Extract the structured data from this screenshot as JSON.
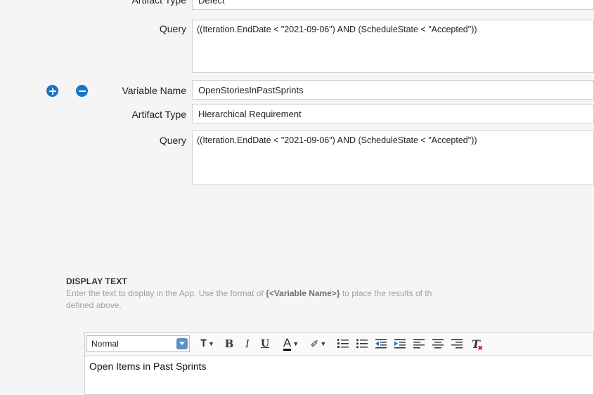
{
  "top_block": {
    "artifact_type_label": "Artifact Type",
    "artifact_type_value": "Defect",
    "query_label": "Query",
    "query_value": "((Iteration.EndDate < \"2021-09-06\") AND (ScheduleState < \"Accepted\"))"
  },
  "variable_block": {
    "add_icon": "plus-circle-icon",
    "remove_icon": "minus-circle-icon",
    "variable_name_label": "Variable Name",
    "variable_name_value": "OpenStoriesInPastSprints",
    "artifact_type_label": "Artifact Type",
    "artifact_type_value": "Hierarchical Requirement",
    "query_label": "Query",
    "query_value": "((Iteration.EndDate < \"2021-09-06\") AND (ScheduleState < \"Accepted\"))"
  },
  "display_text": {
    "heading": "DISPLAY TEXT",
    "help_prefix": "Enter the text to display in the App. Use the format of ",
    "help_bold": "{<Variable Name>}",
    "help_suffix": " to place the results of th",
    "help_line2": "defined above."
  },
  "editor": {
    "format_select_value": "Normal",
    "content": "Open Items in Past Sprints",
    "toolbar_icons": [
      "font-size-icon",
      "bold-icon",
      "italic-icon",
      "underline-icon",
      "text-color-icon",
      "highlight-icon",
      "numbered-list-icon",
      "bullet-list-icon",
      "outdent-icon",
      "indent-icon",
      "align-left-icon",
      "align-center-icon",
      "align-right-icon",
      "clear-format-icon"
    ]
  },
  "colors": {
    "accent_blue": "#1a73c8",
    "background": "#f5f5f5"
  }
}
